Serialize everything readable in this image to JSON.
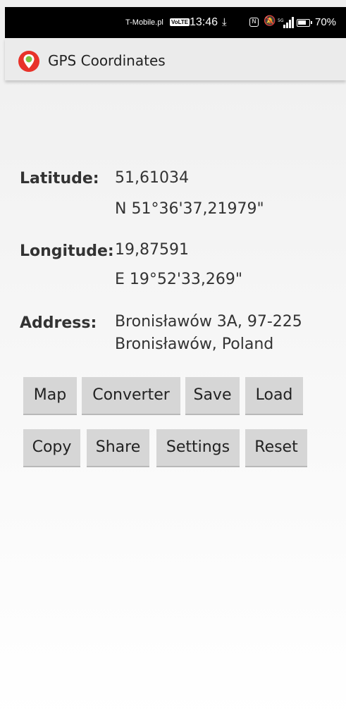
{
  "status_bar": {
    "carrier": "T-Mobile.pl",
    "volte": "VoLTE",
    "time": "13:46",
    "download_icon": "download-icon",
    "nfc_label": "N",
    "mute_icon": "mute-icon",
    "signal_icon": "signal-icon",
    "battery_percent": "70%"
  },
  "app_bar": {
    "title": "GPS Coordinates",
    "icon": "location-pin-icon"
  },
  "fields": {
    "latitude_label": "Latitude:",
    "latitude_decimal": "51,61034",
    "latitude_dms": "N 51°36'37,21979\"",
    "longitude_label": "Longitude:",
    "longitude_decimal": "19,87591",
    "longitude_dms": "E 19°52'33,269\"",
    "address_label": "Address:",
    "address_line1": "Bronisławów 3A, 97-225",
    "address_line2": "Bronisławów, Poland"
  },
  "buttons": {
    "map": "Map",
    "converter": "Converter",
    "save": "Save",
    "load": "Load",
    "copy": "Copy",
    "share": "Share",
    "settings": "Settings",
    "reset": "Reset"
  },
  "colors": {
    "status_bar_bg": "#000000",
    "app_bar_bg": "#ebebeb",
    "button_bg": "#d6d6d6",
    "pin_red": "#e8332a",
    "pin_green": "#7cc242"
  }
}
